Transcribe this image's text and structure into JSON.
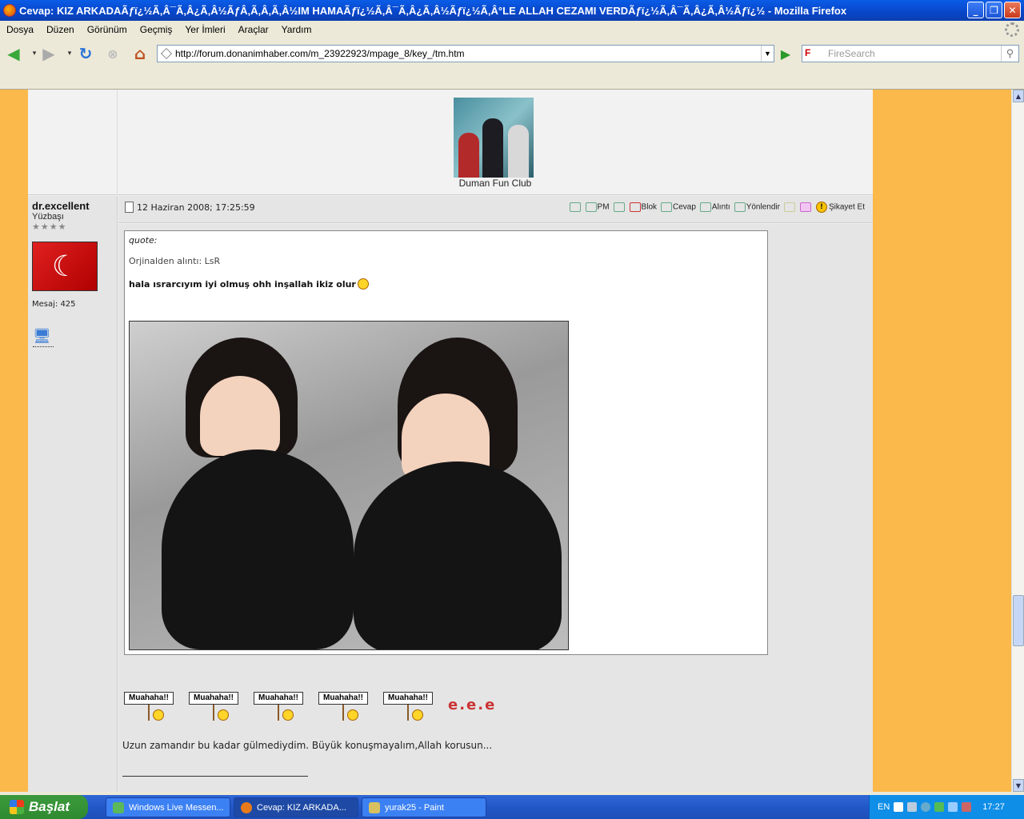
{
  "window": {
    "title": "Cevap: KIZ ARKADAÃƒï¿½Ã‚Â¯Ã‚Â¿Ã‚Â½ÃƒÂ‚Ã‚Â‚Ã‚Â½IM HAMAÃƒï¿½Ã‚Â¯Ã‚Â¿Ã‚Â½Ãƒï¿½Ã‚Â°LE ALLAH CEZAMI VERDÃƒï¿½Ã‚Â¯Ã‚Â¿Ã‚Â½Ãƒï¿½ - Mozilla Firefox"
  },
  "menu": [
    "Dosya",
    "Düzen",
    "Görünüm",
    "Geçmiş",
    "Yer İmleri",
    "Araçlar",
    "Yardım"
  ],
  "nav": {
    "url": "http://forum.donanimhaber.com/m_23922923/mpage_8/key_/tm.htm",
    "search_placeholder": "FireSearch",
    "search_engine": "F"
  },
  "signature": {
    "caption": "Duman Fun Club"
  },
  "user": {
    "name": "dr.excellent",
    "rank": "Yüzbaşı",
    "stars": "★★★★",
    "messages": "Mesaj: 425"
  },
  "post": {
    "date": "12 Haziran 2008; 17:25:59",
    "actions": {
      "pm": "PM",
      "block": "Blok",
      "reply": "Cevap",
      "quote": "Alıntı",
      "forward": "Yönlendir",
      "report": "Şikayet Et"
    },
    "quote_label": "quote:",
    "quote_from": "Orjinalden alıntı: LsR",
    "quote_text": "hala ısrarcıyım iyi olmuş ohh inşallah ikiz olur",
    "emote_text": "Muahaha!!",
    "ege_text": "e.e.e",
    "body": "Uzun zamandır bu kadar gülmediydim. Büyük konuşmayalım,Allah korusun..."
  },
  "taskbar": {
    "start": "Başlat",
    "tasks": [
      {
        "label": "Windows Live Messen..."
      },
      {
        "label": "Cevap: KIZ ARKADA..."
      },
      {
        "label": "yurak25 - Paint"
      }
    ],
    "lang": "EN",
    "clock": "17:27"
  },
  "colors": {
    "page_bg": "#fcb94b",
    "panel": "#e5e5e5",
    "titlebar": "#0a5ce6",
    "taskbar": "#2157c7"
  }
}
